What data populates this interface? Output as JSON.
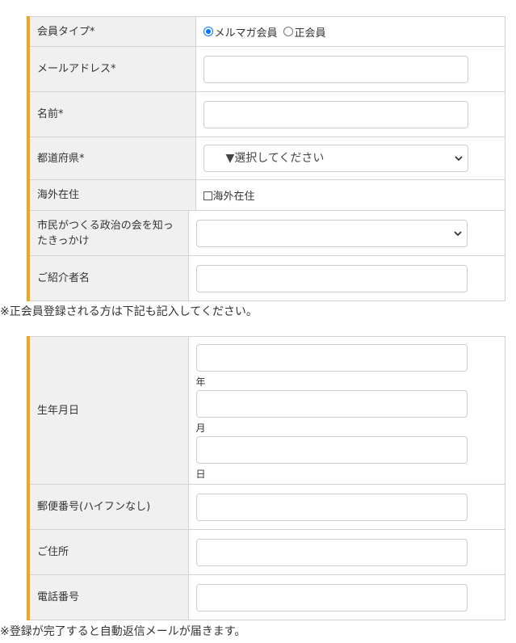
{
  "form1": {
    "member_type": {
      "label": "会員タイプ*",
      "options": [
        {
          "label": "メルマガ会員",
          "checked": true
        },
        {
          "label": "正会員",
          "checked": false
        }
      ]
    },
    "email": {
      "label": "メールアドレス*",
      "value": ""
    },
    "name": {
      "label": "名前*",
      "value": ""
    },
    "prefecture": {
      "label": "都道府県*",
      "selected": "▼選択してください"
    },
    "overseas": {
      "label": "海外在住",
      "checkbox_label": "海外在住",
      "checked": false
    },
    "referral_source": {
      "label_line1": "市民がつくる政治の会を知っ",
      "label_line2": "たきっかけ",
      "selected": ""
    },
    "referrer_name": {
      "label": "ご紹介者名",
      "value": ""
    }
  },
  "note_regular": "※正会員登録される方は下記も記入してください。",
  "form2": {
    "birthdate": {
      "label": "生年月日",
      "year_unit": "年",
      "month_unit": "月",
      "day_unit": "日"
    },
    "postal_code": {
      "label": "郵便番号(ハイフンなし)",
      "value": ""
    },
    "address": {
      "label": "ご住所",
      "value": ""
    },
    "phone": {
      "label": "電話番号",
      "value": ""
    }
  },
  "note_complete": "※登録が完了すると自動返信メールが届きます。",
  "colors": {
    "accent": "#f6a21d",
    "label_bg": "#f0f0f0",
    "border": "#d2d2d2",
    "radio": "#0075ff"
  }
}
